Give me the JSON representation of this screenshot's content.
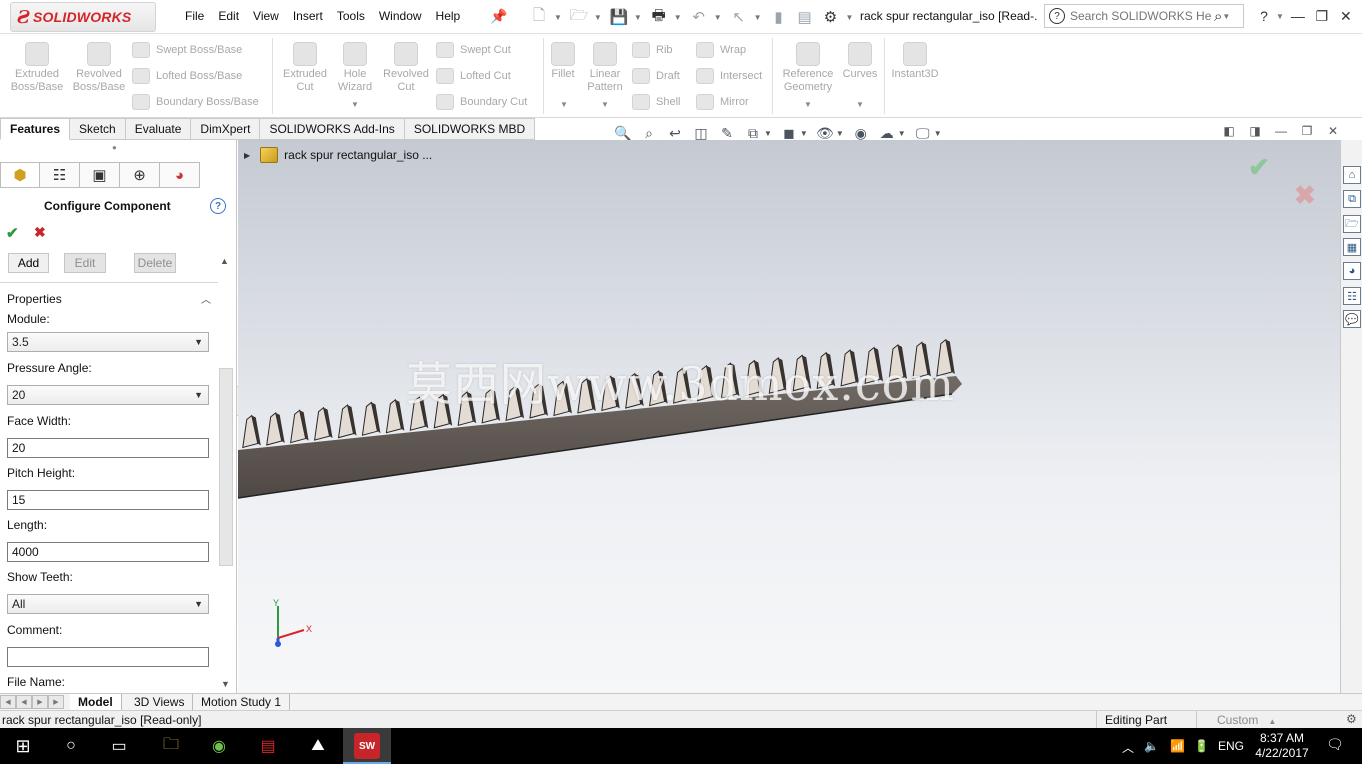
{
  "app": {
    "logo_text": "SOLIDWORKS",
    "doc_title": "rack spur rectangular_iso [Read-...",
    "menus": [
      "File",
      "Edit",
      "View",
      "Insert",
      "Tools",
      "Window",
      "Help"
    ],
    "search_placeholder": "Search SOLIDWORKS Help",
    "help_glyph": "?"
  },
  "ribbon": {
    "extruded_boss": "Extruded Boss/Base",
    "revolved_boss": "Revolved Boss/Base",
    "swept_boss": "Swept Boss/Base",
    "lofted_boss": "Lofted Boss/Base",
    "boundary_boss": "Boundary Boss/Base",
    "extruded_cut": "Extruded Cut",
    "hole_wizard": "Hole Wizard",
    "revolved_cut": "Revolved Cut",
    "swept_cut": "Swept Cut",
    "lofted_cut": "Lofted Cut",
    "boundary_cut": "Boundary Cut",
    "fillet": "Fillet",
    "linear_pattern": "Linear Pattern",
    "rib": "Rib",
    "draft": "Draft",
    "shell": "Shell",
    "wrap": "Wrap",
    "intersect": "Intersect",
    "mirror": "Mirror",
    "reference_geometry": "Reference Geometry",
    "curves": "Curves",
    "instant3d": "Instant3D"
  },
  "tabs": [
    "Features",
    "Sketch",
    "Evaluate",
    "DimXpert",
    "SOLIDWORKS Add-Ins",
    "SOLIDWORKS MBD"
  ],
  "panel": {
    "title": "Configure Component",
    "add_label": "Add",
    "edit_label": "Edit",
    "delete_label": "Delete",
    "properties_header": "Properties",
    "module_label": "Module:",
    "module_value": "3.5",
    "pressure_angle_label": "Pressure Angle:",
    "pressure_angle_value": "20",
    "face_width_label": "Face Width:",
    "face_width_value": "20",
    "pitch_height_label": "Pitch Height:",
    "pitch_height_value": "15",
    "length_label": "Length:",
    "length_value": "4000",
    "show_teeth_label": "Show Teeth:",
    "show_teeth_value": "All",
    "comment_label": "Comment:",
    "comment_value": "",
    "file_name_label": "File Name:"
  },
  "viewport": {
    "tree_root": "rack spur rectangular_iso  ...",
    "watermark": "莫西网www.3dmox.com",
    "axis_x": "X",
    "axis_y": "Y"
  },
  "bottom_tabs": [
    "Model",
    "3D Views",
    "Motion Study 1"
  ],
  "status": {
    "text": "rack spur rectangular_iso [Read-only]",
    "mode": "Editing Part",
    "units": "Custom"
  },
  "taskbar": {
    "language": "ENG",
    "time": "8:37 AM",
    "date": "4/22/2017",
    "sw_badge": "SW"
  },
  "colors": {
    "brand_red": "#d6252a",
    "ok_green": "#2e9a3c",
    "cancel_red": "#c8252a",
    "rack_face": "#e3dcd4",
    "rack_side": "#5b5450"
  }
}
